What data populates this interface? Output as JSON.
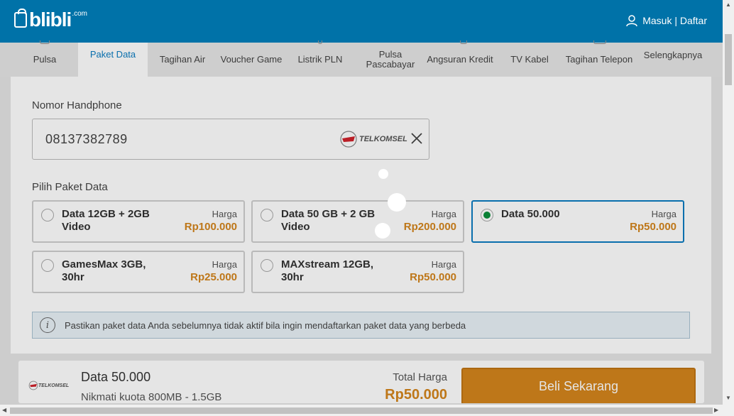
{
  "header": {
    "logo_text": "blibli",
    "logo_suffix": ".com",
    "auth_label": "Masuk | Daftar"
  },
  "nav": {
    "items": [
      {
        "label": "Pulsa"
      },
      {
        "label": "Paket Data",
        "active": true
      },
      {
        "label": "Tagihan Air"
      },
      {
        "label": "Voucher Game"
      },
      {
        "label": "Listrik PLN"
      },
      {
        "label": "Pulsa Pascabayar"
      },
      {
        "label": "Angsuran Kredit"
      },
      {
        "label": "TV Kabel"
      },
      {
        "label": "Tagihan Telepon"
      },
      {
        "label": "Selengkapnya"
      }
    ]
  },
  "form": {
    "phone_label": "Nomor Handphone",
    "phone_value": "08137382789",
    "operator": "TELKOMSEL",
    "package_label": "Pilih Paket Data"
  },
  "packages": [
    {
      "name": "Data 12GB + 2GB Video",
      "harga_label": "Harga",
      "price": "Rp100.000",
      "selected": false
    },
    {
      "name": "Data 50 GB + 2 GB Video",
      "harga_label": "Harga",
      "price": "Rp200.000",
      "selected": false
    },
    {
      "name": "Data 50.000",
      "harga_label": "Harga",
      "price": "Rp50.000",
      "selected": true
    },
    {
      "name": "GamesMax 3GB, 30hr",
      "harga_label": "Harga",
      "price": "Rp25.000",
      "selected": false
    },
    {
      "name": "MAXstream 12GB, 30hr",
      "harga_label": "Harga",
      "price": "Rp50.000",
      "selected": false
    }
  ],
  "info": {
    "icon": "info-icon",
    "text": "Pastikan paket data Anda sebelumnya tidak aktif bila ingin mendaftarkan paket data yang berbeda"
  },
  "summary": {
    "operator": "TELKOMSEL",
    "name": "Data 50.000",
    "description": "Nikmati kuota 800MB - 1.5GB",
    "total_label": "Total Harga",
    "total": "Rp50.000",
    "buy_label": "Beli Sekarang"
  },
  "colors": {
    "header": "#0072a8",
    "accent": "#0b7cc1",
    "price": "#d4851c",
    "selected_radio": "#0c8f3c"
  }
}
